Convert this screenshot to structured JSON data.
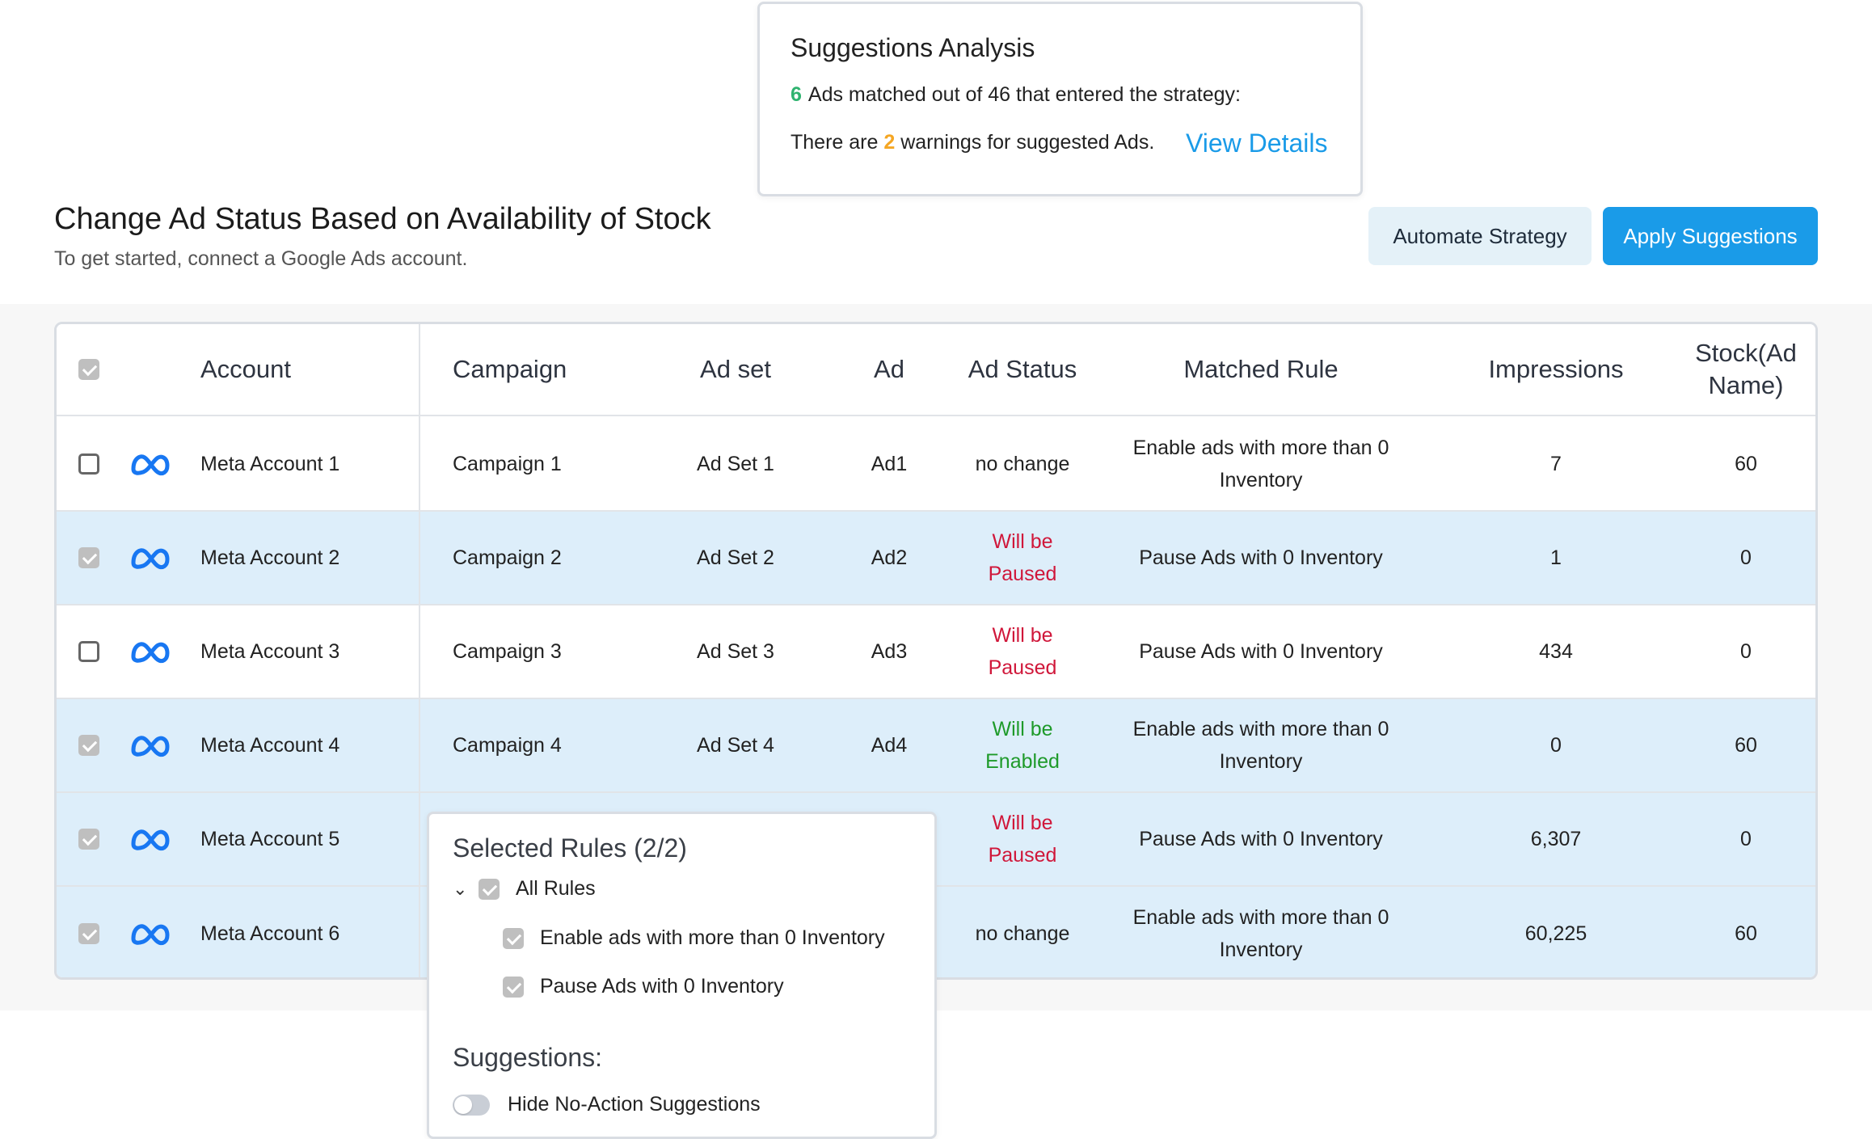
{
  "analysis": {
    "title": "Suggestions Analysis",
    "matched_count": "6",
    "matched_text": "Ads matched out of 46 that entered the strategy:",
    "warnings_prefix": "There are",
    "warnings_count": "2",
    "warnings_suffix": "warnings for suggested Ads.",
    "view_details": "View Details"
  },
  "header": {
    "title": "Change Ad Status Based on Availability of Stock",
    "subtitle": "To get started, connect a Google Ads account.",
    "automate_label": "Automate Strategy",
    "apply_label": "Apply Suggestions"
  },
  "table": {
    "columns": {
      "account": "Account",
      "campaign": "Campaign",
      "adset": "Ad set",
      "ad": "Ad",
      "status": "Ad Status",
      "rule": "Matched Rule",
      "impressions": "Impressions",
      "stock_line1": "Stock(Ad",
      "stock_line2": "Name)"
    },
    "header_checked": true,
    "rows": [
      {
        "checked": false,
        "account": "Meta Account 1",
        "campaign": "Campaign 1",
        "adset": "Ad Set 1",
        "ad": "Ad1",
        "status_line1": "no change",
        "status_line2": "",
        "status_color": "neutral",
        "rule_line1": "Enable ads with more than 0",
        "rule_line2": "Inventory",
        "impressions": "7",
        "stock": "60"
      },
      {
        "checked": true,
        "account": "Meta Account 2",
        "campaign": "Campaign 2",
        "adset": "Ad Set 2",
        "ad": "Ad2",
        "status_line1": "Will be",
        "status_line2": "Paused",
        "status_color": "red",
        "rule_line1": "Pause Ads with 0 Inventory",
        "rule_line2": "",
        "impressions": "1",
        "stock": "0"
      },
      {
        "checked": false,
        "account": "Meta Account 3",
        "campaign": "Campaign 3",
        "adset": "Ad Set 3",
        "ad": "Ad3",
        "status_line1": "Will be",
        "status_line2": "Paused",
        "status_color": "red",
        "rule_line1": "Pause Ads with 0 Inventory",
        "rule_line2": "",
        "impressions": "434",
        "stock": "0"
      },
      {
        "checked": true,
        "account": "Meta Account 4",
        "campaign": "Campaign 4",
        "adset": "Ad Set 4",
        "ad": "Ad4",
        "status_line1": "Will be",
        "status_line2": "Enabled",
        "status_color": "green",
        "rule_line1": "Enable ads with more than 0",
        "rule_line2": "Inventory",
        "impressions": "0",
        "stock": "60"
      },
      {
        "checked": true,
        "account": "Meta Account 5",
        "campaign": "",
        "adset": "",
        "ad": "",
        "status_line1": "Will be",
        "status_line2": "Paused",
        "status_color": "red",
        "rule_line1": "Pause Ads with 0 Inventory",
        "rule_line2": "",
        "impressions": "6,307",
        "stock": "0"
      },
      {
        "checked": true,
        "account": "Meta Account 6",
        "campaign": "",
        "adset": "",
        "ad": "",
        "status_line1": "no change",
        "status_line2": "",
        "status_color": "neutral",
        "rule_line1": "Enable ads with more than 0",
        "rule_line2": "Inventory",
        "impressions": "60,225",
        "stock": "60"
      }
    ]
  },
  "rules_popover": {
    "title": "Selected Rules (2/2)",
    "all_rules": "All Rules",
    "rule1": "Enable ads with more than 0 Inventory",
    "rule2": "Pause Ads with 0 Inventory",
    "suggestions_title": "Suggestions:",
    "toggle_label": "Hide No-Action Suggestions",
    "toggle_on": false
  },
  "colors": {
    "accent": "#1a9be8",
    "selected_row": "#ddeefa",
    "red_status": "#d0173a",
    "green_status": "#1e9a2a",
    "matched_green": "#2fb36f",
    "warning_orange": "#f5a623"
  },
  "icons": {
    "row_icon": "meta-logo-icon",
    "expand": "chevron-down-icon"
  }
}
